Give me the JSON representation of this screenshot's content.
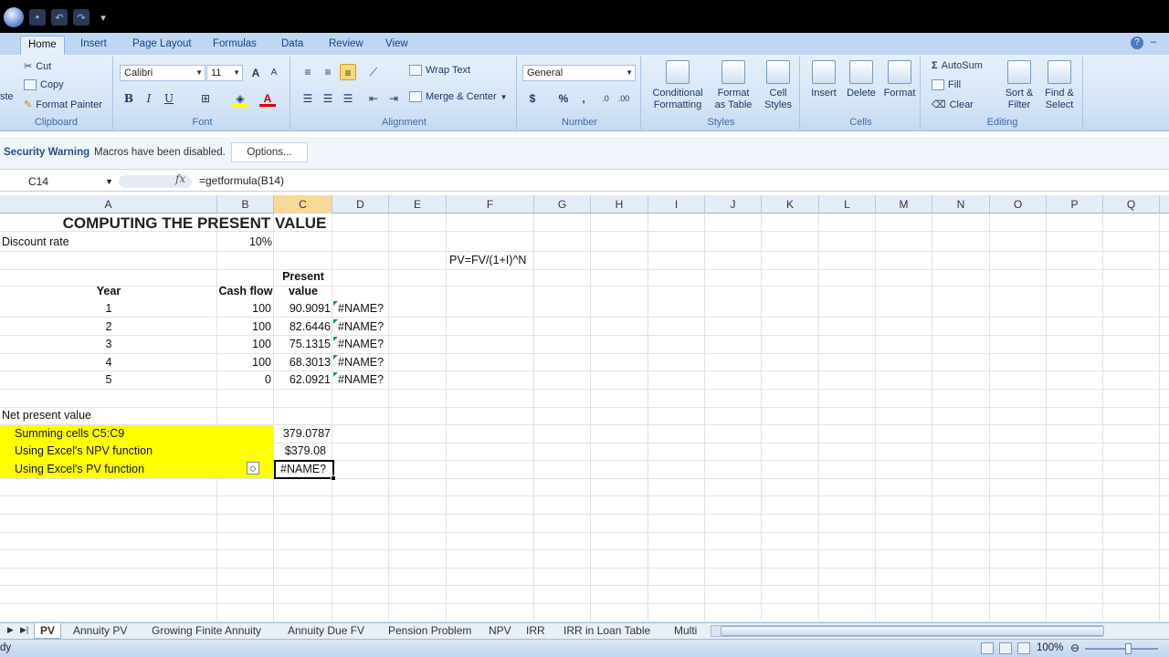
{
  "ribbon_tabs": [
    "Home",
    "Insert",
    "Page Layout",
    "Formulas",
    "Data",
    "Review",
    "View"
  ],
  "clipboard": {
    "paste": "ste",
    "cut": "Cut",
    "copy": "Copy",
    "format_painter": "Format Painter",
    "label": "Clipboard"
  },
  "font": {
    "name": "Calibri",
    "size": "11",
    "bold": "B",
    "italic": "I",
    "underline": "U",
    "label": "Font"
  },
  "alignment": {
    "wrap_text": "Wrap Text",
    "merge_center": "Merge & Center",
    "label": "Alignment"
  },
  "number": {
    "format": "General",
    "currency": "$",
    "percent": "%",
    "comma": ",",
    "label": "Number"
  },
  "styles": {
    "conditional": "Conditional Formatting",
    "format_table": "Format as Table",
    "cell_styles": "Cell Styles",
    "label": "Styles",
    "conditional_l1": "Conditional",
    "conditional_l2": "Formatting",
    "format_table_l1": "Format",
    "format_table_l2": "as Table",
    "cell_styles_l1": "Cell",
    "cell_styles_l2": "Styles"
  },
  "cells": {
    "insert": "Insert",
    "delete": "Delete",
    "format": "Format",
    "label": "Cells"
  },
  "editing": {
    "autosum": "AutoSum",
    "fill": "Fill",
    "clear": "Clear",
    "sort_l1": "Sort &",
    "sort_l2": "Filter",
    "find_l1": "Find &",
    "find_l2": "Select",
    "label": "Editing"
  },
  "security": {
    "warning": "Security Warning",
    "message": "Macros have been disabled.",
    "options": "Options..."
  },
  "formula_bar": {
    "name_box": "C14",
    "fx": "fx",
    "formula": "=getformula(B14)"
  },
  "columns": [
    "A",
    "B",
    "C",
    "D",
    "E",
    "F",
    "G",
    "H",
    "I",
    "J",
    "K",
    "L",
    "M",
    "N",
    "O",
    "P",
    "Q"
  ],
  "sheet": {
    "title": "COMPUTING THE PRESENT VALUE",
    "discount_label": "Discount rate",
    "discount_value": "10%",
    "formula_note": "PV=FV/(1+I)^N",
    "hdr_year": "Year",
    "hdr_cash": "Cash flow",
    "hdr_pv_1": "Present",
    "hdr_pv_2": "value",
    "rows": [
      {
        "year": "1",
        "cash": "100",
        "pv": "90.9091",
        "err": "#NAME?"
      },
      {
        "year": "2",
        "cash": "100",
        "pv": "82.6446",
        "err": "#NAME?"
      },
      {
        "year": "3",
        "cash": "100",
        "pv": "75.1315",
        "err": "#NAME?"
      },
      {
        "year": "4",
        "cash": "100",
        "pv": "68.3013",
        "err": "#NAME?"
      },
      {
        "year": "5",
        "cash": "0",
        "pv": "62.0921",
        "err": "#NAME?"
      }
    ],
    "npv_label": "Net present value",
    "sum_label": "Summing cells C5:C9",
    "sum_value": "379.0787",
    "npv_fn_label": "Using Excel's NPV function",
    "npv_fn_value": "$379.08",
    "pv_fn_label": "Using Excel's PV function",
    "pv_fn_value": "#NAME?"
  },
  "sheet_tabs": [
    "PV",
    "Annuity PV",
    "Growing Finite Annuity",
    "Annuity Due FV",
    "Pension Problem",
    "NPV",
    "IRR",
    "IRR in Loan Table",
    "Multi"
  ],
  "status": {
    "text": "dy",
    "zoom": "100%"
  },
  "colors": {
    "highlight": "#ffff00",
    "selected_column": "#f9d99a",
    "ribbon": "#d3e3f6"
  }
}
